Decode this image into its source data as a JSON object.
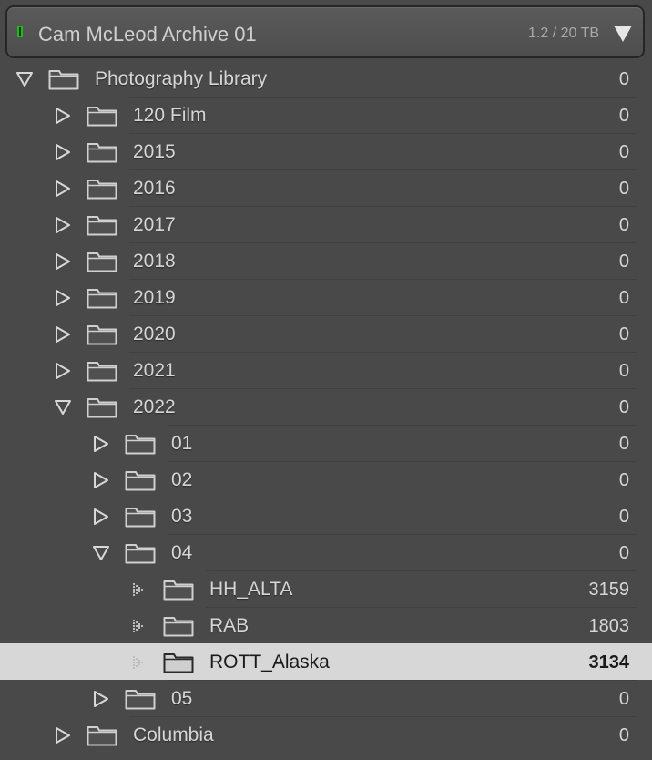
{
  "volume": {
    "name": "Cam McLeod Archive 01",
    "usage": "1.2 / 20 TB",
    "status_color": "#1fb81f"
  },
  "folders": [
    {
      "label": "Photography Library",
      "count": "0",
      "depth": 0,
      "state": "expanded",
      "selected": false
    },
    {
      "label": "120 Film",
      "count": "0",
      "depth": 1,
      "state": "collapsed",
      "selected": false
    },
    {
      "label": "2015",
      "count": "0",
      "depth": 1,
      "state": "collapsed",
      "selected": false
    },
    {
      "label": "2016",
      "count": "0",
      "depth": 1,
      "state": "collapsed",
      "selected": false
    },
    {
      "label": "2017",
      "count": "0",
      "depth": 1,
      "state": "collapsed",
      "selected": false
    },
    {
      "label": "2018",
      "count": "0",
      "depth": 1,
      "state": "collapsed",
      "selected": false
    },
    {
      "label": "2019",
      "count": "0",
      "depth": 1,
      "state": "collapsed",
      "selected": false
    },
    {
      "label": "2020",
      "count": "0",
      "depth": 1,
      "state": "collapsed",
      "selected": false
    },
    {
      "label": "2021",
      "count": "0",
      "depth": 1,
      "state": "collapsed",
      "selected": false
    },
    {
      "label": "2022",
      "count": "0",
      "depth": 1,
      "state": "expanded",
      "selected": false
    },
    {
      "label": "01",
      "count": "0",
      "depth": 2,
      "state": "collapsed",
      "selected": false
    },
    {
      "label": "02",
      "count": "0",
      "depth": 2,
      "state": "collapsed",
      "selected": false
    },
    {
      "label": "03",
      "count": "0",
      "depth": 2,
      "state": "collapsed",
      "selected": false
    },
    {
      "label": "04",
      "count": "0",
      "depth": 2,
      "state": "expanded",
      "selected": false
    },
    {
      "label": "HH_ALTA",
      "count": "3159",
      "depth": 3,
      "state": "leaf",
      "selected": false
    },
    {
      "label": "RAB",
      "count": "1803",
      "depth": 3,
      "state": "leaf",
      "selected": false
    },
    {
      "label": "ROTT_Alaska",
      "count": "3134",
      "depth": 3,
      "state": "leaf",
      "selected": true
    },
    {
      "label": "05",
      "count": "0",
      "depth": 2,
      "state": "collapsed",
      "selected": false
    },
    {
      "label": "Columbia",
      "count": "0",
      "depth": 1,
      "state": "collapsed",
      "selected": false
    }
  ],
  "icons": {
    "expanded": "triangle-down-icon",
    "collapsed": "triangle-right-icon",
    "leaf": "dotted-triangle-icon",
    "folder": "folder-icon",
    "volume_menu": "triangle-down-icon"
  },
  "colors": {
    "panel_bg": "#494949",
    "selected_bg": "#d7d7d7",
    "text": "#d6d6d6",
    "selected_text": "#1a1a1a"
  }
}
